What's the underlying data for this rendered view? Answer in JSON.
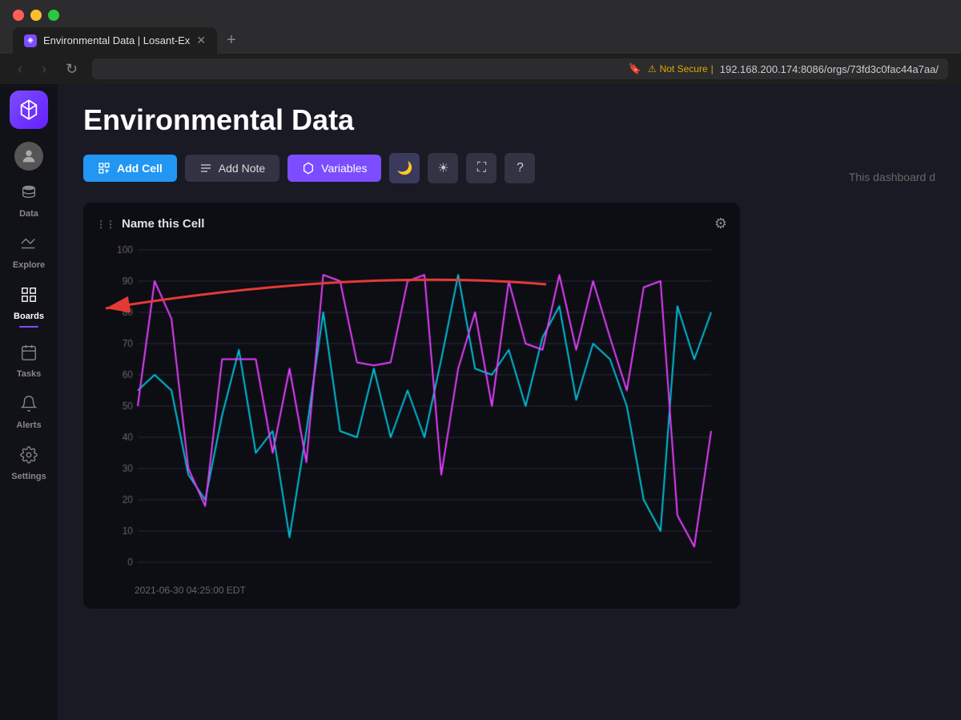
{
  "browser": {
    "tab_title": "Environmental Data | Losant-Ex",
    "tab_favicon": "◈",
    "address_not_secure": "Not Secure",
    "address_url": "192.168.200.174:8086/orgs/73fd3c0fac44a7aa/",
    "new_tab_label": "+"
  },
  "sidebar": {
    "logo_icon": "◈",
    "items": [
      {
        "id": "avatar",
        "label": "",
        "icon": "👤",
        "active": false
      },
      {
        "id": "data",
        "label": "Data",
        "icon": "🗄",
        "active": false
      },
      {
        "id": "explore",
        "label": "Explore",
        "icon": "⎇",
        "active": false
      },
      {
        "id": "boards",
        "label": "Boards",
        "icon": "⊞",
        "active": true
      },
      {
        "id": "tasks",
        "label": "Tasks",
        "icon": "📅",
        "active": false
      },
      {
        "id": "alerts",
        "label": "Alerts",
        "icon": "🔔",
        "active": false
      },
      {
        "id": "settings",
        "label": "Settings",
        "icon": "🔧",
        "active": false
      }
    ]
  },
  "page": {
    "title": "Environmental Data",
    "dashboard_hint": "This dashboard d",
    "toolbar": {
      "add_cell": "Add Cell",
      "add_note": "Add Note",
      "variables": "Variables",
      "dark_mode_icon": "🌙",
      "light_mode_icon": "☀",
      "fullscreen_icon": "⛶",
      "help_icon": "?"
    },
    "chart_cell": {
      "title": "Name this Cell",
      "x_label": "2021-06-30 04:25:00 EDT",
      "y_axis": [
        0,
        10,
        20,
        30,
        40,
        50,
        60,
        70,
        80,
        90
      ]
    }
  }
}
